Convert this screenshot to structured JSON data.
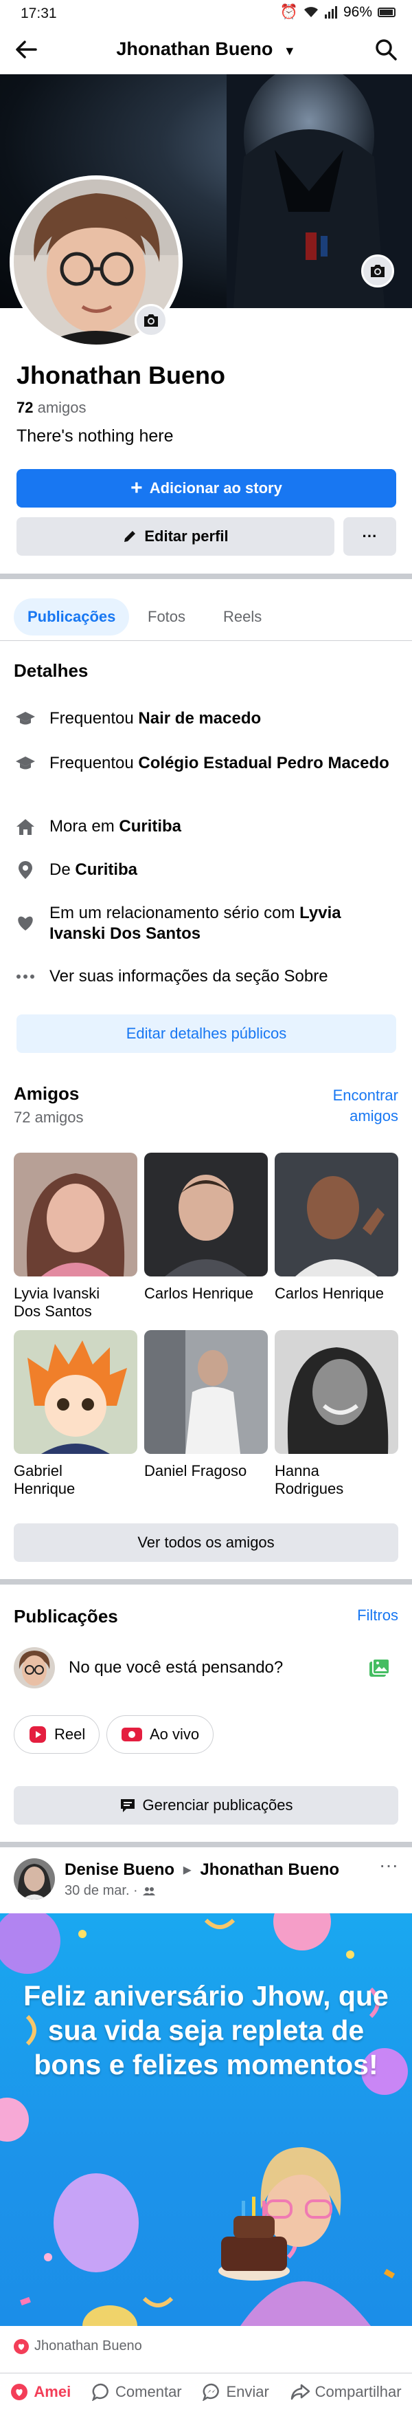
{
  "status_bar": {
    "time": "17:31",
    "battery": "96%"
  },
  "nav": {
    "title": "Jhonathan Bueno",
    "back_icon": "arrow-left-icon",
    "search_icon": "search-icon"
  },
  "profile": {
    "name": "Jhonathan Bueno",
    "friends_count": "72",
    "friends_word": "amigos",
    "bio": "There's nothing here",
    "add_story": "Adicionar ao story",
    "edit_profile": "Editar perfil",
    "more": "···"
  },
  "tabs": [
    "Publicações",
    "Fotos",
    "Reels"
  ],
  "details": {
    "title": "Detalhes",
    "items": [
      {
        "icon": "graduation-cap-icon",
        "prefix": "Frequentou ",
        "bold": "Nair de macedo"
      },
      {
        "icon": "graduation-cap-icon",
        "prefix": "Frequentou ",
        "bold": "Colégio Estadual Pedro Macedo"
      },
      {
        "icon": "home-icon",
        "prefix": "Mora em ",
        "bold": "Curitiba"
      },
      {
        "icon": "location-pin-icon",
        "prefix": "De ",
        "bold": "Curitiba"
      },
      {
        "icon": "heart-icon",
        "prefix": "Em um relacionamento sério com ",
        "bold": "Lyvia Ivanski Dos Santos"
      },
      {
        "icon": "more-dots-icon",
        "prefix": "Ver suas informações da seção Sobre",
        "bold": ""
      }
    ],
    "edit_button": "Editar detalhes públicos"
  },
  "friends": {
    "title": "Amigos",
    "count_text": "72 amigos",
    "find_link_line1": "Encontrar",
    "find_link_line2": "amigos",
    "list": [
      {
        "name_line1": "Lyvia Ivanski",
        "name_line2": "Dos Santos"
      },
      {
        "name_line1": "Carlos Henrique",
        "name_line2": ""
      },
      {
        "name_line1": "Carlos Henrique",
        "name_line2": ""
      },
      {
        "name_line1": "Gabriel",
        "name_line2": "Henrique"
      },
      {
        "name_line1": "Daniel Fragoso",
        "name_line2": ""
      },
      {
        "name_line1": "Hanna",
        "name_line2": "Rodrigues"
      }
    ],
    "see_all": "Ver todos os amigos"
  },
  "posts_section": {
    "title": "Publicações",
    "filters": "Filtros",
    "composer_placeholder": "No que você está pensando?",
    "reel_label": "Reel",
    "live_label": "Ao vivo",
    "manage_posts": "Gerenciar publicações"
  },
  "post": {
    "author": "Denise Bueno",
    "arrow": "▸",
    "target": "Jhonathan Bueno",
    "date": "30 de mar. ·",
    "more": "···",
    "image_text": "Feliz aniversário Jhow, que sua vida seja repleta de bons e felizes momentos!",
    "reaction_name": "Jhonathan Bueno",
    "actions": {
      "like": "Amei",
      "comment": "Comentar",
      "share_send": "Enviar",
      "share": "Compartilhar"
    }
  },
  "colors": {
    "brand_blue": "#1877f2",
    "love_red": "#f33e58",
    "muted": "#65676b"
  }
}
